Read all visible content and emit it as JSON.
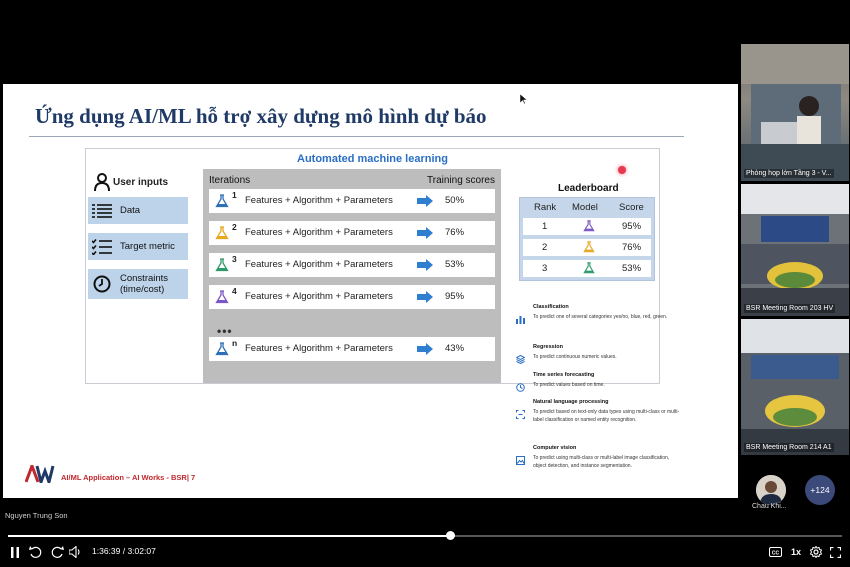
{
  "slide": {
    "title": "Ứng dụng AI/ML hỗ trợ xây dựng mô hình dự báo",
    "diagram_title": "Automated machine learning",
    "user_inputs": {
      "heading": "User inputs",
      "items": [
        {
          "label": "Data",
          "icon": "data-table-icon"
        },
        {
          "label": "Target metric",
          "icon": "checklist-icon"
        },
        {
          "label": "Constraints (time/cost)",
          "icon": "clock-icon"
        }
      ]
    },
    "iterations": {
      "header_left": "Iterations",
      "header_right": "Training scores",
      "formula": "Features + Algorithm + Parameters",
      "ellipsis": "•••",
      "rows": [
        {
          "num": "1",
          "score": "50%",
          "color": "#2e6fb5"
        },
        {
          "num": "2",
          "score": "76%",
          "color": "#e6a820"
        },
        {
          "num": "3",
          "score": "53%",
          "color": "#2e9a6a"
        },
        {
          "num": "4",
          "score": "95%",
          "color": "#7b56c4"
        },
        {
          "num": "n",
          "score": "43%",
          "color": "#2e6fb5"
        }
      ]
    },
    "leaderboard": {
      "title": "Leaderboard",
      "headers": [
        "Rank",
        "Model",
        "Score"
      ],
      "rows": [
        {
          "rank": "1",
          "score": "95%",
          "color": "#7b56c4"
        },
        {
          "rank": "2",
          "score": "76%",
          "color": "#e6a820"
        },
        {
          "rank": "3",
          "score": "53%",
          "color": "#2e9a6a"
        }
      ]
    },
    "tasks": [
      {
        "title": "Classification",
        "desc": "To predict one of several categories yes/no, blue, red, green.",
        "icon": "bar-chart-icon"
      },
      {
        "title": "Regression",
        "desc": "To predict continuous numeric values.",
        "icon": "layers-icon"
      },
      {
        "title": "Time series forecasting",
        "desc": "To predict values based on time.",
        "icon": "clock-icon"
      },
      {
        "title": "Natural language processing",
        "desc": "To predict based on text-only data types using multi-class or multi-label classification or named entity recognition.",
        "icon": "text-scan-icon"
      },
      {
        "title": "Computer vision",
        "desc": "To predict using multi-class or multi-label image classification, object detection, and instance segmentation.",
        "icon": "image-icon"
      }
    ],
    "footer": "AI/ML Application – AI Works - BSR|  7"
  },
  "participants": [
    {
      "caption": "Phòng họp lớn Tầng 3 - V..."
    },
    {
      "caption": "BSR Meeting Room 203 HV"
    },
    {
      "caption": "BSR Meeting Room 214 A1"
    }
  ],
  "avatar": {
    "name": "Chau Khi..."
  },
  "more_count": "+124",
  "presenter": "Nguyen Trung Son",
  "player": {
    "time": "1:36:39 / 3:02:07",
    "speed": "1x",
    "progress_fraction": 0.53,
    "skip_back": "10",
    "skip_forward": "10"
  },
  "colors": {
    "accent": "#2a6fc4",
    "input_box": "#bcd3ea",
    "footer_red": "#c0282e"
  }
}
